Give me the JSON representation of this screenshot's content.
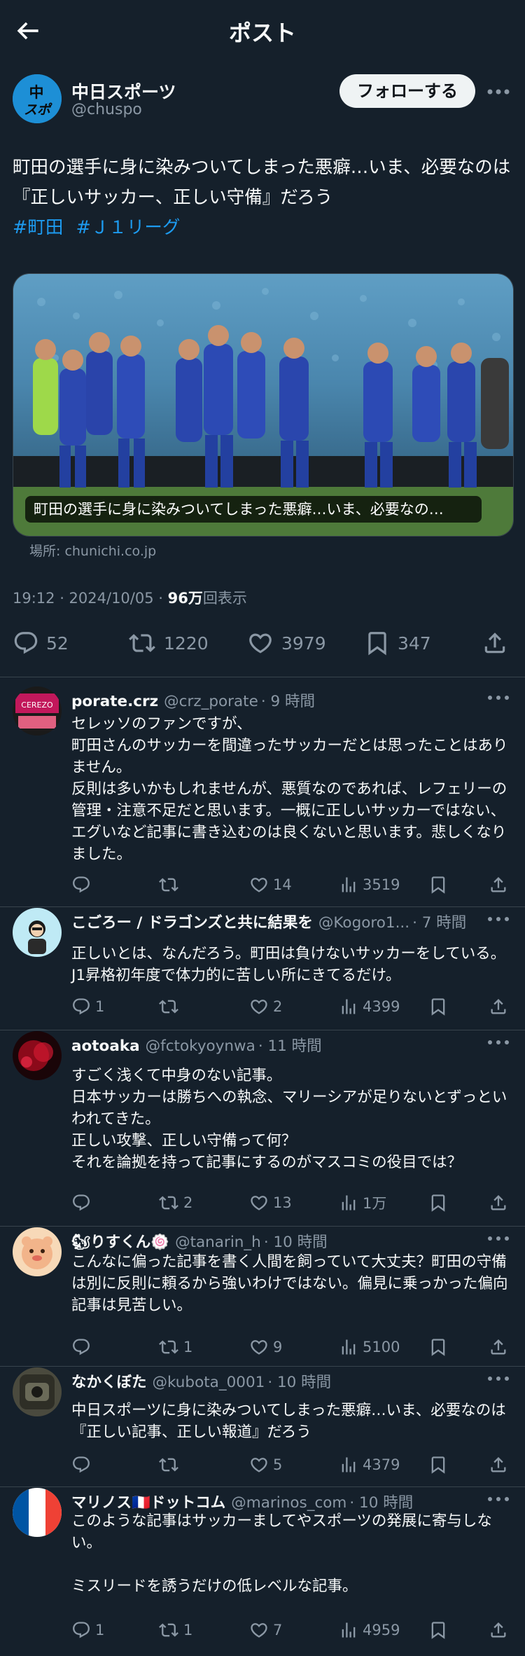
{
  "header": {
    "title": "ポスト"
  },
  "author": {
    "name": "中日スポーツ",
    "handle": "@chuspo",
    "avatar_text": "中スポ",
    "follow_label": "フォローする"
  },
  "post": {
    "text": "町田の選手に身に染みついてしまった悪癖…いま、必要なのは『正しいサッカー、正しい守備』だろう",
    "hashtags": [
      "#町田",
      "#Ｊ１リーグ"
    ],
    "image_caption": "町田の選手に身に染みついてしまった悪癖…いま、必要なの…",
    "location": "場所: chunichi.co.jp",
    "time": "19:12 · 2024/10/05 · ",
    "views": "96万",
    "views_suffix": "回表示",
    "replies": "52",
    "reposts": "1220",
    "likes": "3979",
    "bookmarks": "347"
  },
  "replies": [
    {
      "name": "porate.crz",
      "handle": "@crz_porate",
      "time": "· 9 時間",
      "text": "セレッソのファンですが、\n町田さんのサッカーを間違ったサッカーだとは思ったことはありません。\n反則は多いかもしれませんが、悪質なのであれば、レフェリーの管理・注意不足だと思います。一概に正しいサッカーではない、エグいなど記事に書き込むのは良くないと思います。悲しくなりました。",
      "reply_count": "",
      "repost_count": "",
      "like_count": "14",
      "view_count": "3519",
      "avatar_color": "#c2185b"
    },
    {
      "name": "こごろー / ドラゴンズと共に結果を",
      "handle": "@Kogoro1...",
      "time": "· 7 時間",
      "text": "正しいとは、なんだろう。町田は負けないサッカーをしている。J1昇格初年度で体力的に苦しい所にきてるだけ。",
      "reply_count": "1",
      "repost_count": "",
      "like_count": "2",
      "view_count": "4399",
      "avatar_color": "#bfeaf5"
    },
    {
      "name": "aotoaka",
      "handle": "@fctokyoynwa",
      "time": "· 11 時間",
      "text": "すごく浅くて中身のない記事。\n日本サッカーは勝ちへの執念、マリーシアが足りないとずっといわれてきた。\n正しい攻撃、正しい守備って何？\nそれを論拠を持って記事にするのがマスコミの役目では？",
      "reply_count": "",
      "repost_count": "2",
      "like_count": "13",
      "view_count": "1万",
      "avatar_color": "#8b0a1a"
    },
    {
      "name": "🐿りすくん🍥",
      "handle": "@tanarin_h",
      "time": "· 10 時間",
      "text": "こんなに偏った記事を書く人間を飼っていて大丈夫？町田の守備は別に反則に頼るから強いわけではない。偏見に乗っかった偏向記事は見苦しい。",
      "reply_count": "",
      "repost_count": "1",
      "like_count": "9",
      "view_count": "5100",
      "avatar_color": "#f2b48a"
    },
    {
      "name": "なかくぼた",
      "handle": "@kubota_0001",
      "time": "· 10 時間",
      "text": "中日スポーツに身に染みついてしまった悪癖…いま、必要なのは『正しい記事、正しい報道』だろう",
      "reply_count": "",
      "repost_count": "",
      "like_count": "5",
      "view_count": "4379",
      "avatar_color": "#3a3a32"
    },
    {
      "name": "マリノス🇫🇷ドットコム",
      "handle": "@marinos_com",
      "time": "· 10 時間",
      "text": "このような記事はサッカーましてやスポーツの発展に寄与しない。\n\nミスリードを誘うだけの低レベルな記事。",
      "reply_count": "1",
      "repost_count": "1",
      "like_count": "7",
      "view_count": "4959",
      "avatar_color": "#ffffff"
    }
  ],
  "colors": {
    "background": "#15202b",
    "text": "#f7f9f9",
    "muted": "#8b98a5",
    "link": "#1d9bf0",
    "divider": "#38444d"
  }
}
